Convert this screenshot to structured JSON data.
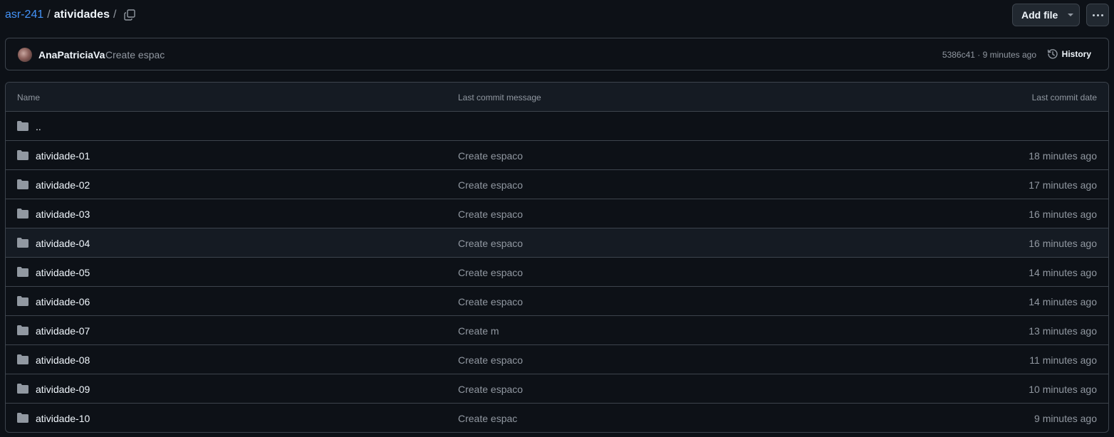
{
  "breadcrumb": {
    "repo": "asr-241",
    "separator": "/",
    "dir": "atividades",
    "trail": "/"
  },
  "actions": {
    "add_file": "Add file"
  },
  "commit": {
    "author": "AnaPatriciaVa",
    "message": "Create espac",
    "meta": "5386c41 · 9 minutes ago",
    "history_label": "History"
  },
  "table": {
    "headers": {
      "name": "Name",
      "message": "Last commit message",
      "date": "Last commit date"
    },
    "parent": "..",
    "rows": [
      {
        "name": "atividade-01",
        "message": "Create espaco",
        "date": "18 minutes ago"
      },
      {
        "name": "atividade-02",
        "message": "Create espaco",
        "date": "17 minutes ago"
      },
      {
        "name": "atividade-03",
        "message": "Create espaco",
        "date": "16 minutes ago"
      },
      {
        "name": "atividade-04",
        "message": "Create espaco",
        "date": "16 minutes ago"
      },
      {
        "name": "atividade-05",
        "message": "Create espaco",
        "date": "14 minutes ago"
      },
      {
        "name": "atividade-06",
        "message": "Create espaco",
        "date": "14 minutes ago"
      },
      {
        "name": "atividade-07",
        "message": "Create m",
        "date": "13 minutes ago"
      },
      {
        "name": "atividade-08",
        "message": "Create espaco",
        "date": "11 minutes ago"
      },
      {
        "name": "atividade-09",
        "message": "Create espaco",
        "date": "10 minutes ago"
      },
      {
        "name": "atividade-10",
        "message": "Create espac",
        "date": "9 minutes ago"
      }
    ]
  },
  "icons": {
    "folder": "folder-icon",
    "copy": "copy-icon",
    "history": "history-icon",
    "more": "kebab-icon",
    "caret": "caret-down-icon"
  },
  "colors": {
    "background": "#0d1117",
    "link": "#4493f8",
    "border": "#3d444d",
    "muted": "#9198a1",
    "folder": "#9198a1"
  }
}
